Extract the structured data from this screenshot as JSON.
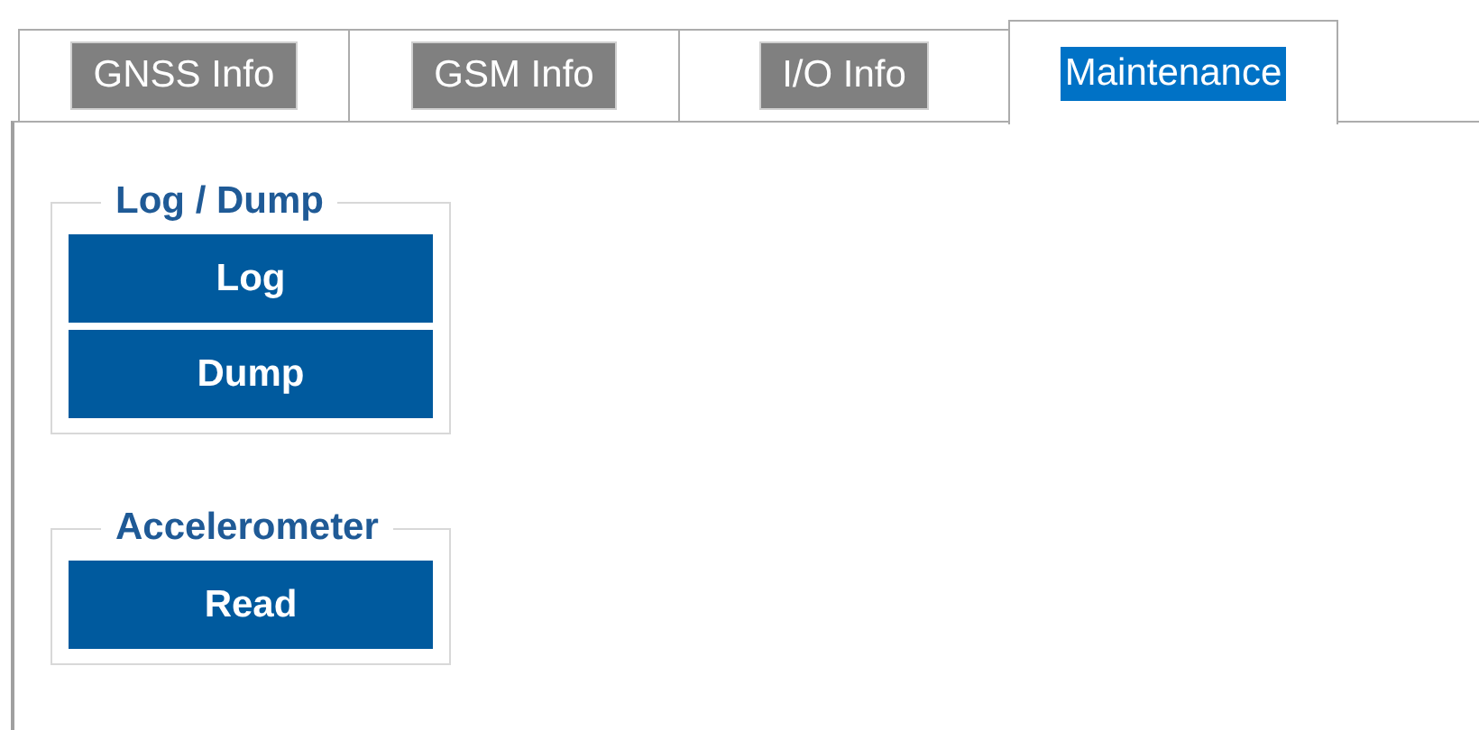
{
  "tabs": [
    {
      "label": "GNSS Info",
      "selected": false
    },
    {
      "label": "GSM Info",
      "selected": false
    },
    {
      "label": "I/O Info",
      "selected": false
    },
    {
      "label": "Maintenance",
      "selected": true
    }
  ],
  "groups": [
    {
      "title": "Log / Dump",
      "buttons": [
        "Log",
        "Dump"
      ]
    },
    {
      "title": "Accelerometer",
      "buttons": [
        "Read"
      ]
    }
  ]
}
